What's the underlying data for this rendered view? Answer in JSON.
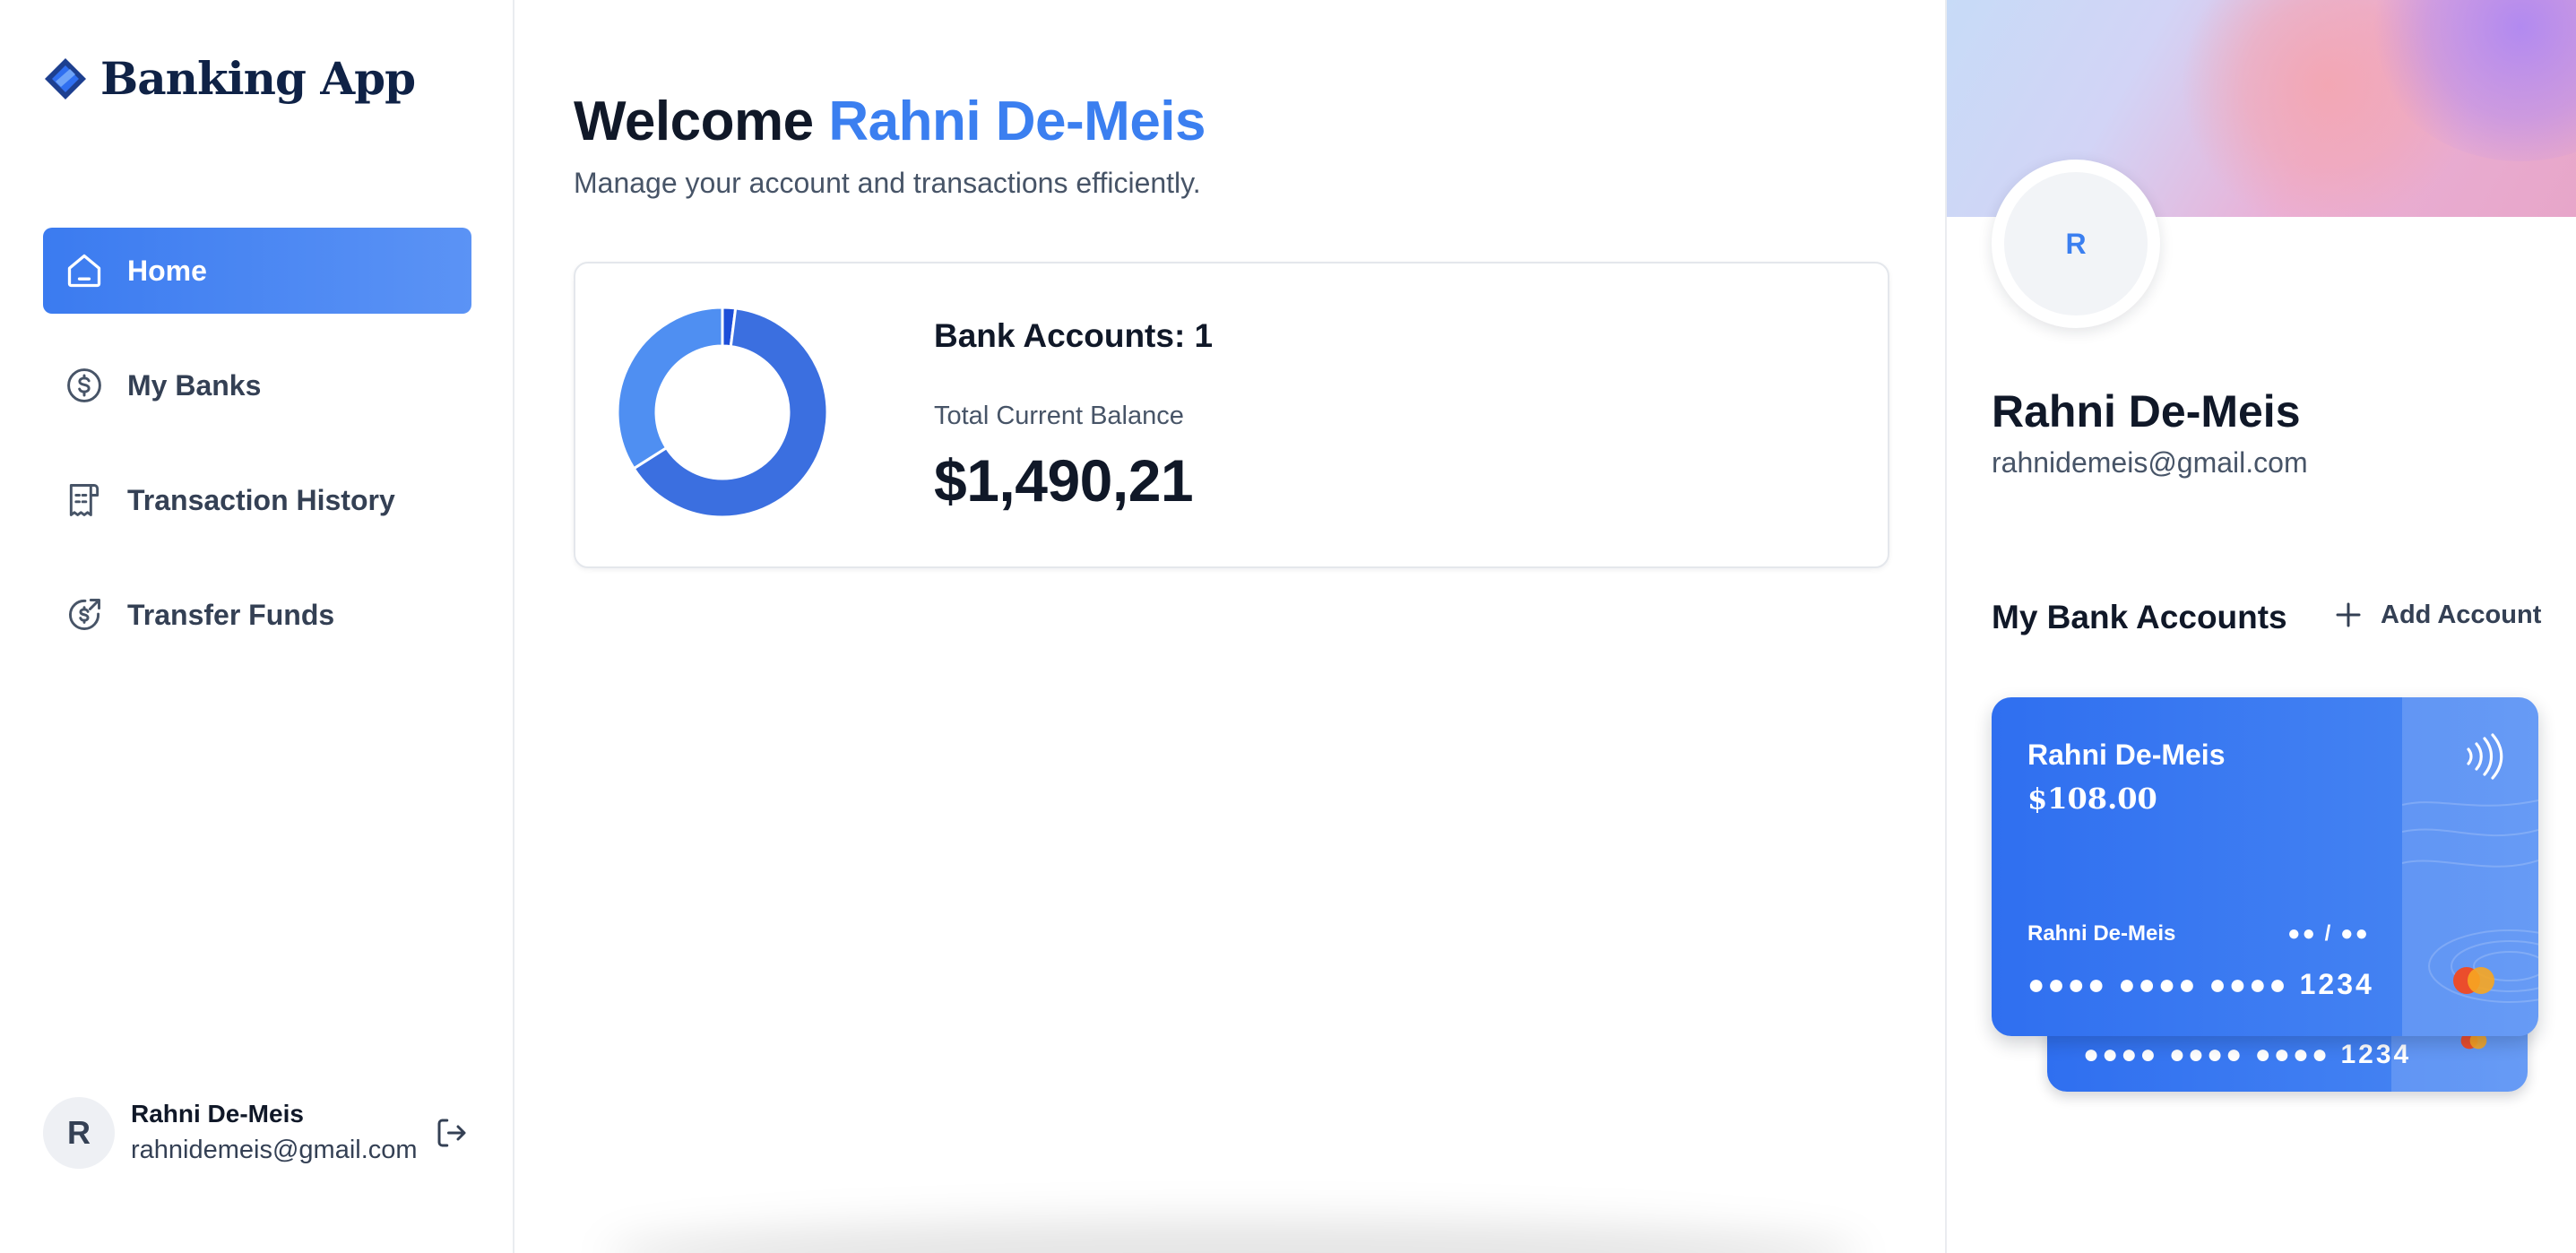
{
  "brand": {
    "name": "Banking App",
    "icon": "logo-icon"
  },
  "nav": {
    "items": [
      {
        "label": "Home",
        "icon": "home-icon",
        "active": true
      },
      {
        "label": "My Banks",
        "icon": "dollar-circle-icon",
        "active": false
      },
      {
        "label": "Transaction History",
        "icon": "receipt-icon",
        "active": false
      },
      {
        "label": "Transfer Funds",
        "icon": "money-send-icon",
        "active": false
      }
    ]
  },
  "sidebar_user": {
    "initial": "R",
    "name": "Rahni De-Meis",
    "email": "rahnidemeis@gmail.com",
    "logout_icon": "logout-icon"
  },
  "header": {
    "welcome": "Welcome",
    "user_name": "Rahni De-Meis",
    "subtitle": "Manage your account and transactions efficiently."
  },
  "balance": {
    "bank_accounts_text": "Bank Accounts: 1",
    "total_label": "Total Current Balance",
    "total_amount": "$1,490,21"
  },
  "chart_data": {
    "type": "pie",
    "variant": "donut",
    "values": [
      2,
      64,
      34
    ],
    "colors": [
      "#1d4ed8",
      "#3b6fe0",
      "#4f8ff2"
    ]
  },
  "profile": {
    "initial": "R",
    "name": "Rahni De-Meis",
    "email": "rahnidemeis@gmail.com"
  },
  "accounts": {
    "title": "My Bank Accounts",
    "add_label": "Add Account",
    "add_icon": "plus-icon",
    "cards": [
      {
        "name": "Rahni De-Meis",
        "balance": "$108.00",
        "holder": "Rahni De-Meis",
        "expiry": "●● / ●●",
        "number": "●●●● ●●●● ●●●● 1234",
        "icons": [
          "contactless-icon",
          "mastercard-icon"
        ]
      },
      {
        "number": "●●●● ●●●● ●●●● 1234"
      }
    ]
  },
  "colors": {
    "accent": "#3b7ff0",
    "nav_active": "#4a88f3",
    "text_primary": "#101828",
    "text_secondary": "#475467"
  }
}
